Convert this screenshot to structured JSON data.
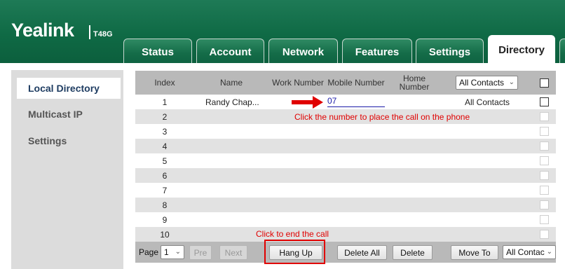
{
  "header": {
    "brand": "Yealink",
    "model": "T48G",
    "tabs": [
      {
        "label": "Status"
      },
      {
        "label": "Account"
      },
      {
        "label": "Network"
      },
      {
        "label": "Features"
      },
      {
        "label": "Settings"
      },
      {
        "label": "Directory",
        "active": true
      }
    ]
  },
  "sidebar": {
    "items": [
      {
        "label": "Local Directory",
        "active": true
      },
      {
        "label": "Multicast IP"
      },
      {
        "label": "Settings"
      }
    ]
  },
  "table": {
    "headers": {
      "index": "Index",
      "name": "Name",
      "work": "Work Number",
      "mobile": "Mobile Number",
      "home": "Home Number"
    },
    "group_filter": "All Contacts",
    "rows": [
      {
        "index": "1",
        "name": "Randy Chap...",
        "mobile": "07",
        "group": "All Contacts"
      },
      {
        "index": "2"
      },
      {
        "index": "3"
      },
      {
        "index": "4"
      },
      {
        "index": "5"
      },
      {
        "index": "6"
      },
      {
        "index": "7"
      },
      {
        "index": "8"
      },
      {
        "index": "9"
      },
      {
        "index": "10"
      }
    ]
  },
  "footer": {
    "page_label": "Page",
    "page_value": "1",
    "prev": "Pre",
    "next": "Next",
    "hang_up": "Hang Up",
    "delete_all": "Delete All",
    "delete": "Delete",
    "move_to": "Move To",
    "move_target": "All Contac"
  },
  "annotations": {
    "call_hint": "Click the number to place the call on the phone",
    "end_hint": "Click to end the call",
    "color": "#e00000"
  },
  "colors": {
    "header_green": "#0f6a45",
    "link_blue": "#1a1aa8"
  }
}
